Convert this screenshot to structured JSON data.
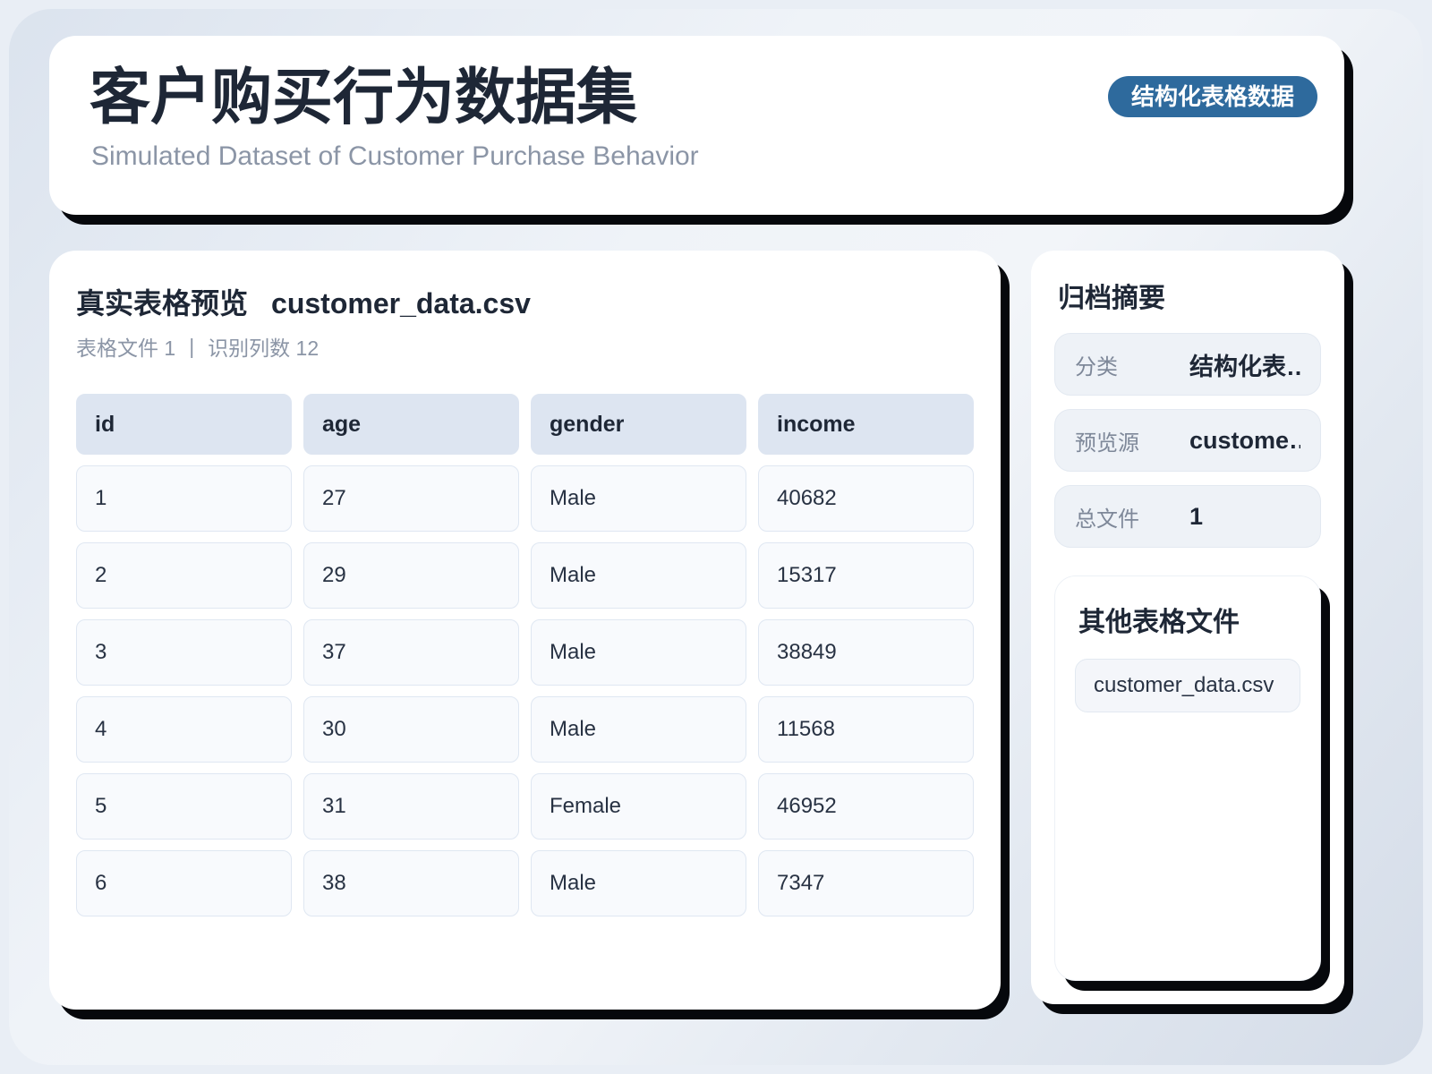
{
  "header": {
    "title": "客户购买行为数据集",
    "subtitle": "Simulated Dataset of Customer Purchase Behavior",
    "badge": "结构化表格数据"
  },
  "preview": {
    "title": "真实表格预览",
    "filename": "customer_data.csv",
    "meta_files": "表格文件 1",
    "meta_separator": "|",
    "meta_columns": "识别列数 12",
    "table": {
      "columns": [
        "id",
        "age",
        "gender",
        "income"
      ],
      "rows": [
        [
          "1",
          "27",
          "Male",
          "40682"
        ],
        [
          "2",
          "29",
          "Male",
          "15317"
        ],
        [
          "3",
          "37",
          "Male",
          "38849"
        ],
        [
          "4",
          "30",
          "Male",
          "11568"
        ],
        [
          "5",
          "31",
          "Female",
          "46952"
        ],
        [
          "6",
          "38",
          "Male",
          "7347"
        ]
      ]
    }
  },
  "sidebar": {
    "summary_title": "归档摘要",
    "stats": [
      {
        "label": "分类",
        "value": "结构化表…"
      },
      {
        "label": "预览源",
        "value": "custome…"
      },
      {
        "label": "总文件",
        "value": "1"
      }
    ],
    "other_files": {
      "title": "其他表格文件",
      "files": [
        "customer_data.csv"
      ]
    }
  },
  "colors": {
    "accent_badge": "#2e6a9d",
    "card_shadow": "#06080c",
    "table_header_bg": "#dde5f1",
    "table_cell_bg": "#f8fafd",
    "stat_row_bg": "#eef2f7"
  }
}
